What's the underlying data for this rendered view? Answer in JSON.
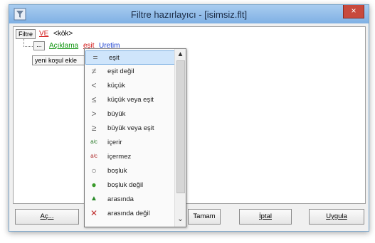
{
  "window": {
    "title": "Filtre hazırlayıcı - [isimsiz.flt]",
    "close_glyph": "×"
  },
  "tree": {
    "root_button": "Filtre",
    "root_operator": "VE",
    "root_label": "<kök>",
    "condition_button": "...",
    "condition_field": "Açıklama",
    "condition_operator": "eşit",
    "condition_value": "Uretim",
    "add_condition": "yeni koşul ekle"
  },
  "operator_menu": {
    "items": [
      {
        "icon": "equals-icon",
        "glyph": "=",
        "label": "eşit",
        "selected": true
      },
      {
        "icon": "not-equal-icon",
        "glyph": "≠",
        "label": "eşit değil"
      },
      {
        "icon": "less-than-icon",
        "glyph": "<",
        "label": "küçük"
      },
      {
        "icon": "less-equal-icon",
        "glyph": "≤",
        "label": "küçük veya eşit"
      },
      {
        "icon": "greater-than-icon",
        "glyph": ">",
        "label": "büyük"
      },
      {
        "icon": "greater-equal-icon",
        "glyph": "≥",
        "label": "büyük veya eşit"
      },
      {
        "icon": "contains-icon",
        "glyph": "aʲc",
        "label": "içerir"
      },
      {
        "icon": "not-contains-icon",
        "glyph": "aʲc",
        "label": "içermez"
      },
      {
        "icon": "empty-circle-icon",
        "glyph": "○",
        "label": "boşluk"
      },
      {
        "icon": "filled-circle-icon",
        "glyph": "●",
        "label": "boşluk değil"
      },
      {
        "icon": "between-icon",
        "glyph": "▲",
        "label": "arasında"
      },
      {
        "icon": "not-between-icon",
        "glyph": "✕",
        "label": "arasında değil"
      }
    ],
    "scroll_up": "▲",
    "scroll_down": "⌄"
  },
  "buttons": {
    "open": "Aç...",
    "ok": "Tamam",
    "cancel": "İptal",
    "apply": "Uygula"
  },
  "colors": {
    "operator_red": "#d21414",
    "field_green": "#119511",
    "value_blue": "#1a3fd0",
    "selection": "#cfe5fb"
  }
}
